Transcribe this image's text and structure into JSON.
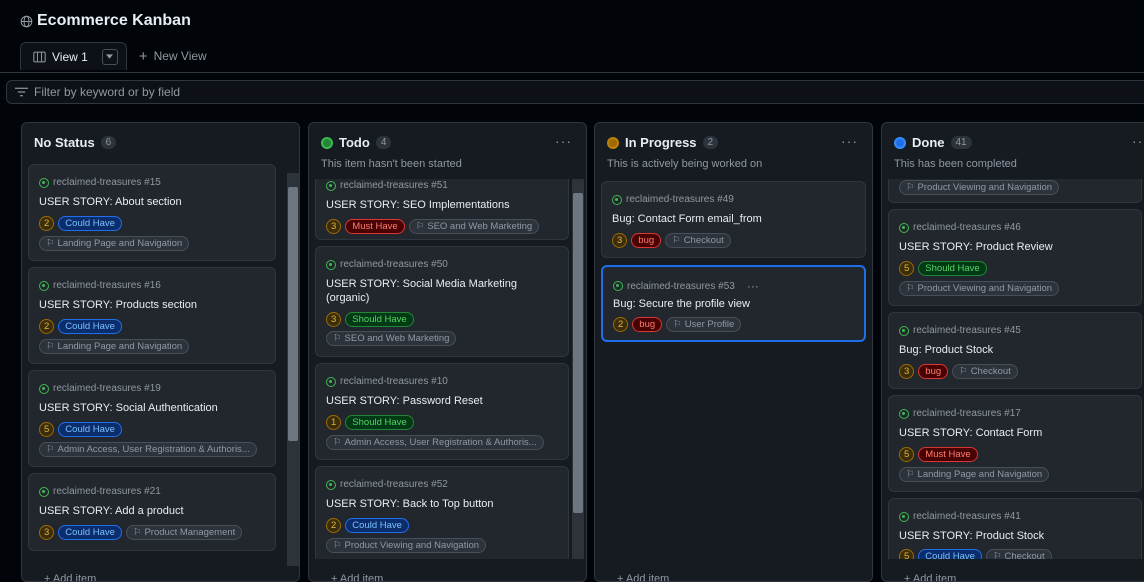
{
  "header": {
    "title": "Ecommerce Kanban",
    "tab_label": "View 1",
    "new_view_label": "New View"
  },
  "filter": {
    "placeholder": "Filter by keyword or by field"
  },
  "colors": {
    "blue": "#1f6feb",
    "green": "#3fb950",
    "orange": "#9e6a03",
    "red": "#da3633"
  },
  "columns": [
    {
      "title": "No Status",
      "count": "6",
      "description": "",
      "add_label": "Add item",
      "cards": [
        {
          "repo": "reclaimed-treasures #15",
          "title": "USER STORY: About section",
          "num": "2",
          "priority": "Could Have",
          "milestone": "Landing Page and Navigation"
        },
        {
          "repo": "reclaimed-treasures #16",
          "title": "USER STORY: Products section",
          "num": "2",
          "priority": "Could Have",
          "milestone": "Landing Page and Navigation"
        },
        {
          "repo": "reclaimed-treasures #19",
          "title": "USER STORY: Social Authentication",
          "num": "5",
          "priority": "Could Have",
          "milestone": "Admin Access, User Registration & Authoris..."
        },
        {
          "repo": "reclaimed-treasures #21",
          "title": "USER STORY: Add a product",
          "num": "3",
          "priority": "Could Have",
          "milestone": "Product Management"
        }
      ]
    },
    {
      "title": "Todo",
      "count": "4",
      "description": "This item hasn't been started",
      "add_label": "Add item",
      "cards": [
        {
          "repo": "reclaimed-treasures #51",
          "title": "USER STORY: SEO Implementations",
          "num": "3",
          "priority": "Must Have",
          "milestone": "SEO and Web Marketing"
        },
        {
          "repo": "reclaimed-treasures #50",
          "title": "USER STORY: Social Media Marketing (organic)",
          "num": "3",
          "priority": "Should Have",
          "milestone": "SEO and Web Marketing"
        },
        {
          "repo": "reclaimed-treasures #10",
          "title": "USER STORY: Password Reset",
          "num": "1",
          "priority": "Should Have",
          "milestone": "Admin Access, User Registration & Authoris..."
        },
        {
          "repo": "reclaimed-treasures #52",
          "title": "USER STORY: Back to Top button",
          "num": "2",
          "priority": "Could Have",
          "milestone": "Product Viewing and Navigation"
        }
      ]
    },
    {
      "title": "In Progress",
      "count": "2",
      "description": "This is actively being worked on",
      "add_label": "Add item",
      "cards": [
        {
          "repo": "reclaimed-treasures #49",
          "title": "Bug: Contact Form email_from",
          "num": "3",
          "priority": "bug",
          "milestone": "Checkout"
        },
        {
          "repo": "reclaimed-treasures #53",
          "title": "Bug: Secure the profile view",
          "num": "2",
          "priority": "bug",
          "milestone": "User Profile"
        }
      ]
    },
    {
      "title": "Done",
      "count": "41",
      "description": "This has been completed",
      "add_label": "Add item",
      "top_milestone": "Product Viewing and Navigation",
      "cards": [
        {
          "repo": "reclaimed-treasures #46",
          "title": "USER STORY: Product Review",
          "num": "5",
          "priority": "Should Have",
          "milestone": "Product Viewing and Navigation"
        },
        {
          "repo": "reclaimed-treasures #45",
          "title": "Bug: Product Stock",
          "num": "3",
          "priority": "bug",
          "milestone": "Checkout"
        },
        {
          "repo": "reclaimed-treasures #17",
          "title": "USER STORY: Contact Form",
          "num": "5",
          "priority": "Must Have",
          "milestone": "Landing Page and Navigation"
        },
        {
          "repo": "reclaimed-treasures #41",
          "title": "USER STORY: Product Stock",
          "num": "5",
          "priority": "Could Have",
          "milestone": "Checkout"
        }
      ]
    }
  ]
}
